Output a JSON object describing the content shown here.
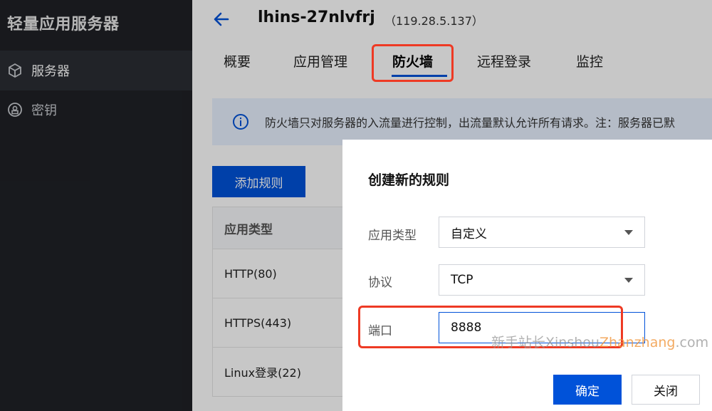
{
  "sidebar": {
    "title": "轻量应用服务器",
    "items": [
      {
        "label": "服务器",
        "icon": "cube-icon",
        "active": true
      },
      {
        "label": "密钥",
        "icon": "key-badge-icon",
        "active": false
      }
    ]
  },
  "header": {
    "instance_name": "lhins-27nlvfrj",
    "instance_ip": "（119.28.5.137）"
  },
  "tabs": [
    {
      "label": "概要"
    },
    {
      "label": "应用管理"
    },
    {
      "label": "防火墙",
      "active": true
    },
    {
      "label": "远程登录"
    },
    {
      "label": "监控"
    }
  ],
  "notice": {
    "text": "防火墙只对服务器的入流量进行控制，出流量默认允许所有请求。注：服务器已默"
  },
  "toolbar": {
    "add_rule_label": "添加规则"
  },
  "table": {
    "header": "应用类型",
    "rows": [
      "HTTP(80)",
      "HTTPS(443)",
      "Linux登录(22)"
    ]
  },
  "modal": {
    "title": "创建新的规则",
    "app_type_label": "应用类型",
    "app_type_value": "自定义",
    "protocol_label": "协议",
    "protocol_value": "TCP",
    "port_label": "端口",
    "port_value": "8888",
    "confirm_label": "确定",
    "close_label": "关闭"
  },
  "watermark": {
    "part1": "新手站长",
    "part2": "Xinshou",
    "part3": "Zhanzhang",
    "part4": ".com"
  },
  "colors": {
    "primary": "#0052d9",
    "highlight": "#ee3a24",
    "sidebar_bg": "#1f2126"
  }
}
